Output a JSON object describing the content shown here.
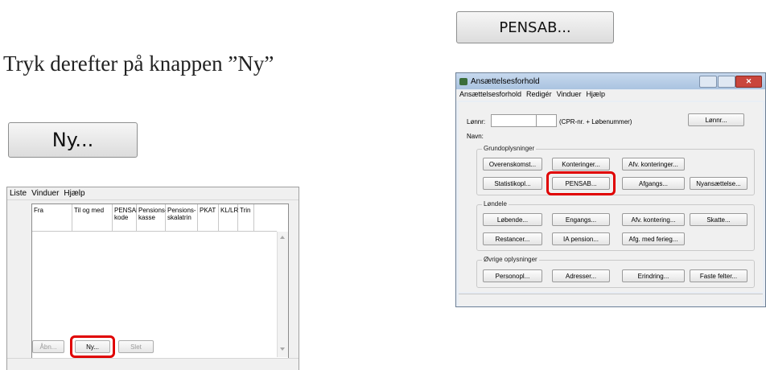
{
  "instruction": "Tryk derefter på knappen ”Ny”",
  "big_buttons": {
    "ny": "Ny...",
    "pensab": "PENSAB..."
  },
  "left_window": {
    "menu": [
      "Liste",
      "Vinduer",
      "Hjælp"
    ],
    "columns": [
      "Fra",
      "Til og med",
      "PENSAB-\nkode",
      "Pensions-\nkasse",
      "Pensions-\nskalatrin",
      "PKAT",
      "KL/LR",
      "Trin"
    ],
    "buttons": {
      "open": "Åbn...",
      "new": "Ny...",
      "delete": "Slet"
    }
  },
  "right_window": {
    "title": "Ansættelsesforhold",
    "menu": [
      "Ansættelsesforhold",
      "Redigér",
      "Vinduer",
      "Hjælp"
    ],
    "lonnr_label": "Lønnr:",
    "cpr_hint": "(CPR-nr. + Løbenummer)",
    "lonnr_button": "Lønnr...",
    "navn_label": "Navn:",
    "groups": {
      "grundoplysninger": {
        "label": "Grundoplysninger",
        "row1": [
          "Overenskomst...",
          "Konteringer...",
          "Afv. konteringer..."
        ],
        "row2": [
          "Statistikopl...",
          "PENSAB...",
          "Afgangs...",
          "Nyansættelse..."
        ]
      },
      "lonndele": {
        "label": "Løndele",
        "row1": [
          "Løbende...",
          "Engangs...",
          "Afv. kontering...",
          "Skatte..."
        ],
        "row2": [
          "Restancer...",
          "IA pension...",
          "Afg. med ferieg..."
        ]
      },
      "ovrige": {
        "label": "Øvrige oplysninger",
        "row1": [
          "Personopl...",
          "Adresser...",
          "Erindring...",
          "Faste felter..."
        ]
      }
    }
  },
  "colors": {
    "highlight": "#e00000",
    "titlebar": "#aac3e0",
    "close": "#c9463d"
  }
}
